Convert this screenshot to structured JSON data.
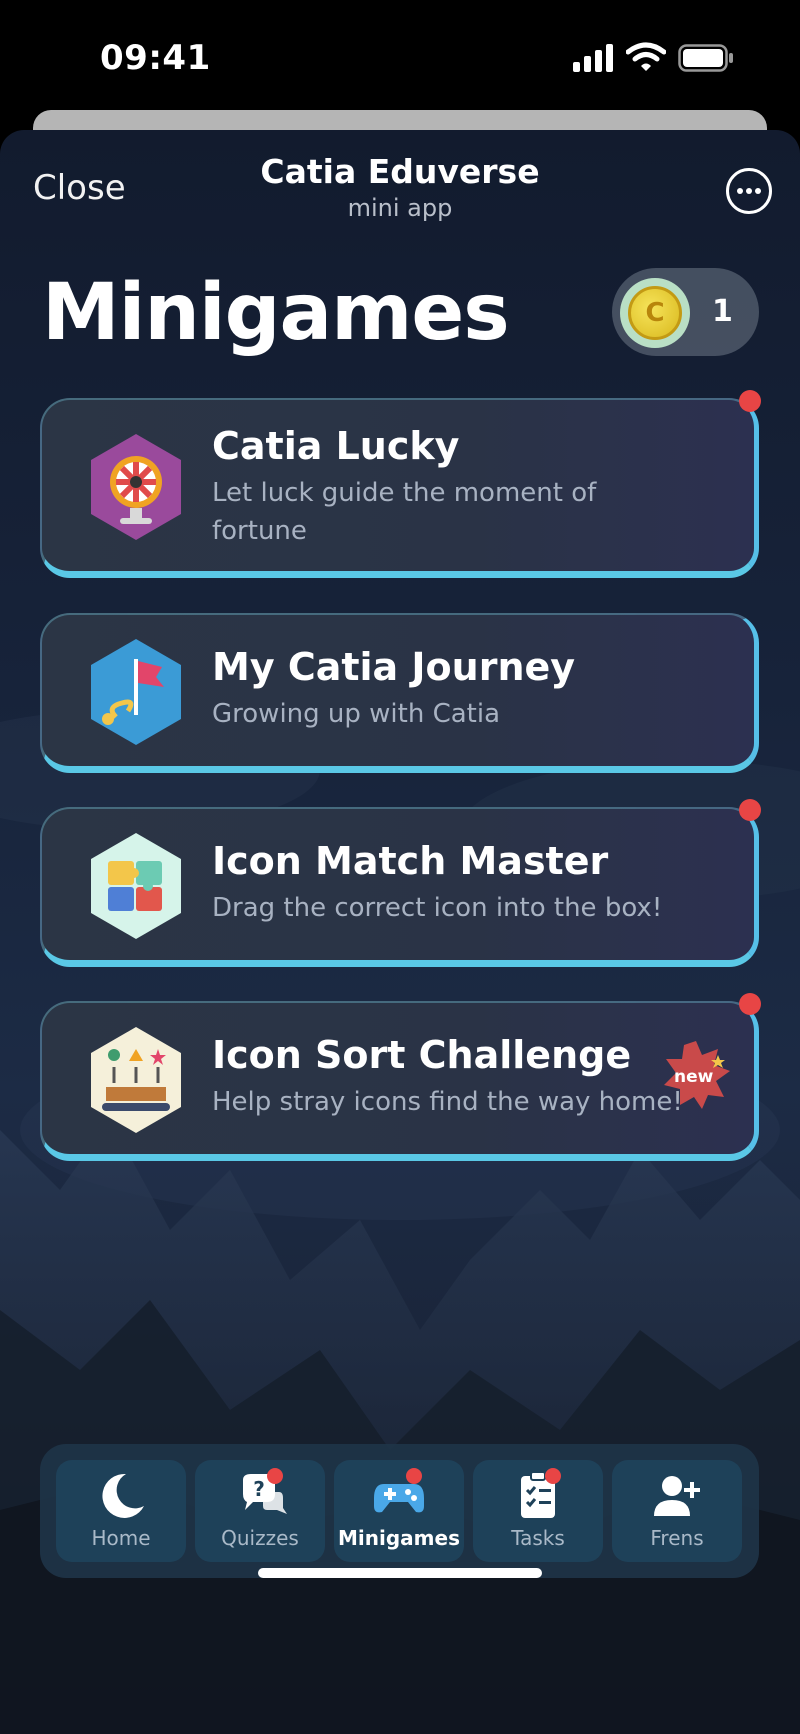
{
  "status_bar": {
    "time": "09:41",
    "icons": [
      "signal-icon",
      "wifi-icon",
      "battery-icon"
    ]
  },
  "header": {
    "close_label": "Close",
    "title": "Catia Eduverse",
    "subtitle": "mini app",
    "more_icon": "more-icon"
  },
  "page": {
    "title": "Minigames"
  },
  "coins": {
    "count": "1",
    "icon": "coin-icon"
  },
  "games": [
    {
      "title": "Catia Lucky",
      "description": "Let luck guide the moment of fortune",
      "icon": "fortune-wheel-icon",
      "has_notification": true,
      "is_new": false
    },
    {
      "title": "My Catia Journey",
      "description": "Growing up with Catia",
      "icon": "journey-flag-icon",
      "has_notification": false,
      "is_new": false
    },
    {
      "title": "Icon Match Master",
      "description": "Drag the correct icon into the box!",
      "icon": "puzzle-icon",
      "has_notification": true,
      "is_new": false
    },
    {
      "title": "Icon Sort Challenge",
      "description": "Help stray icons find the way home!",
      "icon": "sorting-icon",
      "has_notification": true,
      "is_new": true
    }
  ],
  "badge": {
    "new_label": "new"
  },
  "nav": [
    {
      "label": "Home",
      "icon": "moon-icon",
      "active": false,
      "has_notification": false
    },
    {
      "label": "Quizzes",
      "icon": "quiz-bubble-icon",
      "active": false,
      "has_notification": true
    },
    {
      "label": "Minigames",
      "icon": "gamepad-icon",
      "active": true,
      "has_notification": true
    },
    {
      "label": "Tasks",
      "icon": "checklist-icon",
      "active": false,
      "has_notification": true
    },
    {
      "label": "Frens",
      "icon": "add-friend-icon",
      "active": false,
      "has_notification": false
    }
  ],
  "colors": {
    "accent": "#5ac8e6",
    "notification": "#e84545",
    "card_bg": "#2b3545",
    "nav_active_bg": "#1e4159"
  }
}
